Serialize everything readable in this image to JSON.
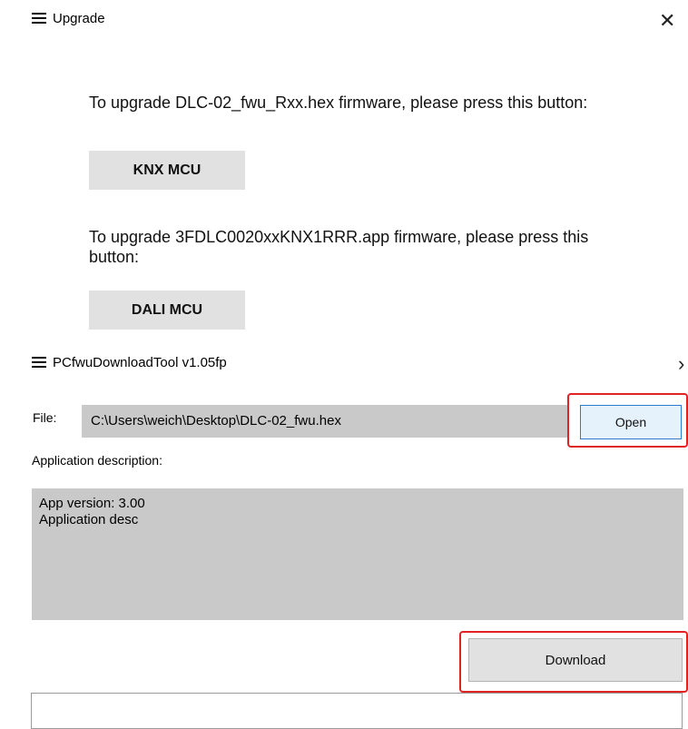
{
  "upgrade_window": {
    "title": "Upgrade",
    "close_glyph": "✕",
    "knx_instruction": "To upgrade DLC-02_fwu_Rxx.hex firmware, please press this button:",
    "knx_button": "KNX MCU",
    "dali_instruction": "To upgrade 3FDLC0020xxKNX1RRR.app firmware, please press this button:",
    "dali_button": "DALI MCU"
  },
  "tool_window": {
    "title": "PCfwuDownloadTool v1.05fp",
    "close_glyph": "›",
    "file_label": "File:",
    "file_path": "C:\\Users\\weich\\Desktop\\DLC-02_fwu.hex",
    "open_button": "Open",
    "app_desc_label": "Application description:",
    "app_desc_lines": [
      "App version: 3.00",
      "Application desc"
    ],
    "download_button": "Download"
  },
  "colors": {
    "highlight_red": "#e02424",
    "field_gray": "#c9c9c9",
    "button_gray": "#e1e1e1",
    "open_button_blue_border": "#2b7bd1"
  },
  "icons": {
    "app_icon": "menu-lines-icon",
    "close_icon": "close-icon"
  }
}
